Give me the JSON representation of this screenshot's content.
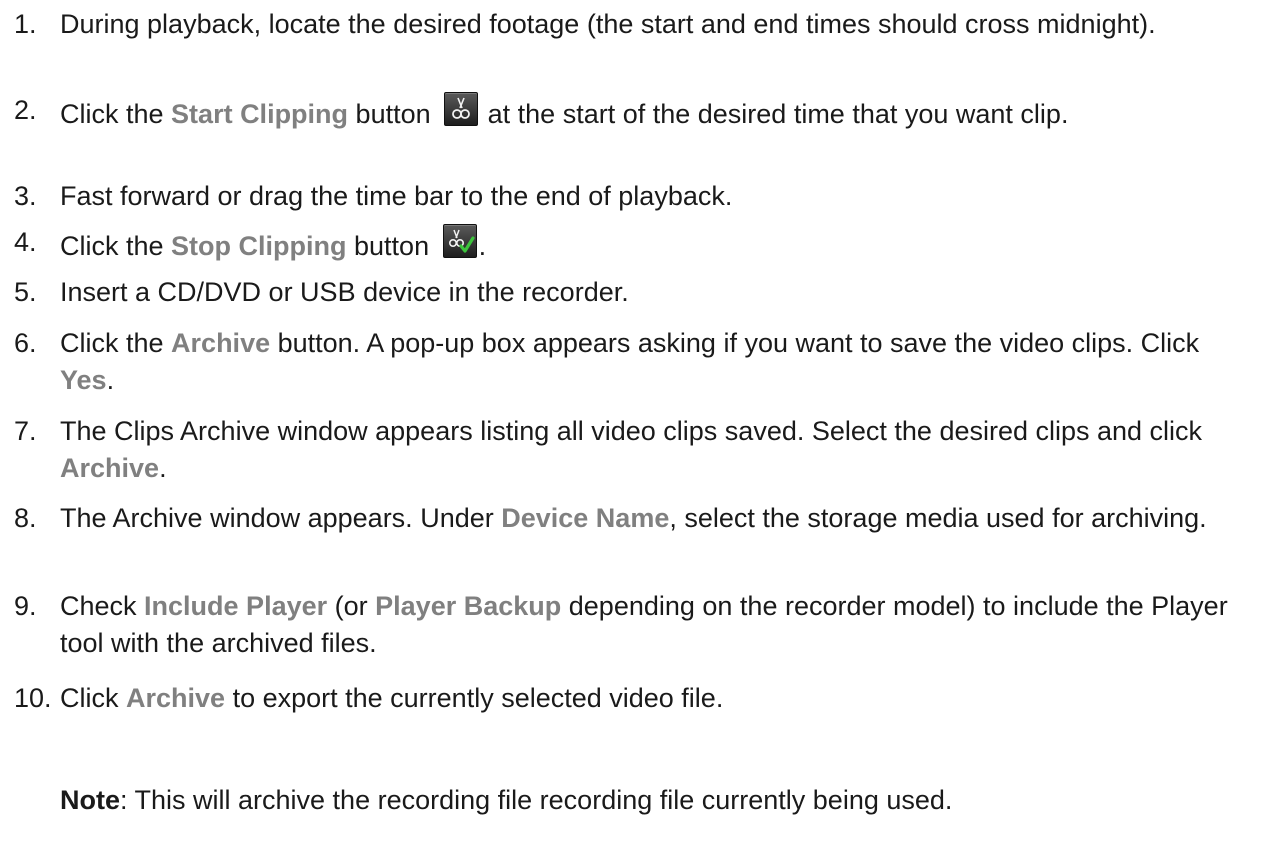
{
  "steps": [
    {
      "num": "1.",
      "text": "During playback, locate the desired footage (the start and end times should cross midnight)."
    },
    {
      "num": "2.",
      "pre": "Click the ",
      "hl": "Start Clipping",
      "mid": " button",
      "post": " at the start of the desired time that you want clip."
    },
    {
      "num": "3.",
      "text": "Fast forward or drag the time bar to the end of playback."
    },
    {
      "num": "4.",
      "pre": "Click the ",
      "hl": "Stop Clipping",
      "mid": " button",
      "post": "."
    },
    {
      "num": "5.",
      "text": "Insert a CD/DVD or USB device in the recorder."
    },
    {
      "num": "6.",
      "pre": "Click the ",
      "hl": "Archive",
      "mid": " button. A pop-up box appears asking if you want to save the video clips. Click ",
      "hl2": "Yes",
      "post": "."
    },
    {
      "num": "7.",
      "pre": "The Clips Archive window appears listing all video clips saved. Select the desired clips and click ",
      "hl": "Archive",
      "post": "."
    },
    {
      "num": "8.",
      "pre": "The Archive window appears. Under ",
      "hl": "Device Name",
      "post": ", select the storage media used for archiving."
    },
    {
      "num": "9.",
      "pre": "Check ",
      "hl": "Include Player",
      "mid": " (or ",
      "hl2": "Player Backup",
      "post": " depending on the recorder model) to include the Player tool with the archived files."
    },
    {
      "num": "10.",
      "pre": "Click ",
      "hl": "Archive",
      "post": " to export the currently selected video file."
    }
  ],
  "note": {
    "label": "Note",
    "text": ": This will archive the recording file recording file currently being used."
  },
  "icons": {
    "start_clipping": "scissors-icon",
    "stop_clipping": "scissors-check-icon"
  },
  "colors": {
    "highlight": "#808080",
    "text": "#1a1a1a"
  }
}
